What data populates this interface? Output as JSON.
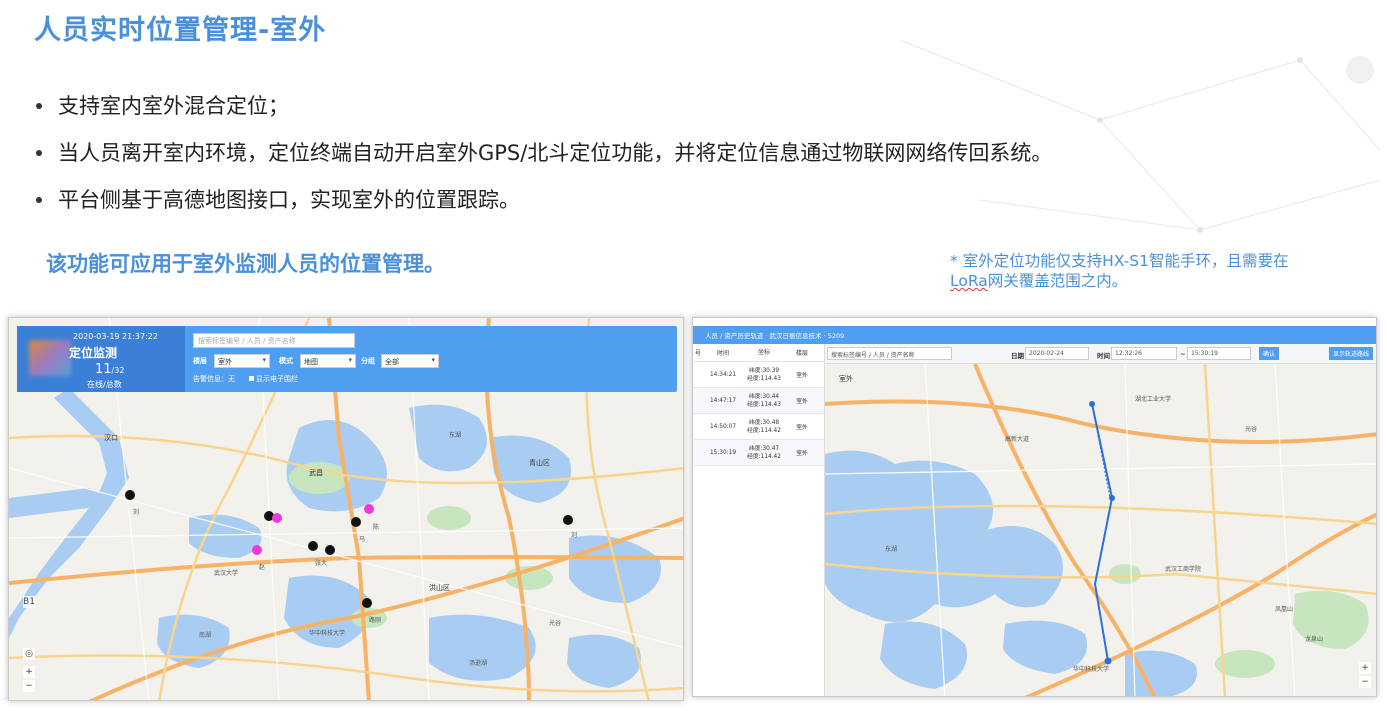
{
  "slide": {
    "title": "人员实时位置管理-室外",
    "bullets": [
      "支持室内室外混合定位；",
      "当人员离开室内环境，定位终端自动开启室外GPS/北斗定位功能，并将定位信息通过物联网网络传回系统。",
      "平台侧基于高德地图接口，实现室外的位置跟踪。"
    ],
    "highlight": "该功能可应用于室外监测人员的位置管理。",
    "footnote_line1": "* 室外定位功能仅支持HX-S1智能手环，且需要在",
    "footnote_line2_a": "LoRa",
    "footnote_line2_b": "网关覆盖范围之内。"
  },
  "left_panel": {
    "timestamp": "2020-03-19 21:37:22",
    "monitor_title": "定位监测",
    "count_main": "11",
    "count_sub": "/32",
    "online_label": "在线/总数",
    "search_placeholder": "搜索标签编号 / 人员 / 资产名称",
    "floor_label": "楼层",
    "floor_value": "室外",
    "mode_label": "模式",
    "mode_value": "地图",
    "group_label": "分组",
    "group_value": "全部",
    "alarm_text": "告警信息：无",
    "fence_text": "显示电子围栏",
    "zoom_in": "+",
    "zoom_out": "−",
    "floor_indicator": "B1",
    "map_labels": {
      "hankou": "汉口",
      "wuchang": "武昌",
      "hongshan": "洪山区",
      "qingshan": "青山区",
      "guanggu": "光谷",
      "wuda": "武汉大学",
      "huake": "华中科技大学",
      "donghu": "东湖",
      "nanhu": "南湖",
      "tangxun": "汤逊湖"
    },
    "marker_labels": [
      "刘",
      "张大",
      "赵",
      "马",
      "刘",
      "陈",
      "路刚"
    ]
  },
  "right_panel": {
    "breadcrumb": "人员 / 资产历史轨迹 · 武汉日振信息技术 · 5209",
    "search_placeholder": "搜索标签编号 / 人员 / 资产名称",
    "date_label": "日期",
    "date_value": "2020-02-24",
    "time_label": "时间",
    "time_from": "12:32:26",
    "time_sep": "~",
    "time_to": "15:30:19",
    "confirm_button": "确认",
    "show_track_button": "显示轨迹路线",
    "table_headers": [
      "号",
      "时间",
      "坐标",
      "楼层"
    ],
    "rows": [
      {
        "time": "14:34:21",
        "lat": "纬度:30.39",
        "lng": "经度:114.43",
        "floor": "室外"
      },
      {
        "time": "14:47:17",
        "lat": "纬度:30.44",
        "lng": "经度:114.43",
        "floor": "室外"
      },
      {
        "time": "14:50:07",
        "lat": "纬度:30.48",
        "lng": "经度:114.42",
        "floor": "室外"
      },
      {
        "time": "15:30:19",
        "lat": "纬度:30.47",
        "lng": "经度:114.42",
        "floor": "室外"
      }
    ],
    "map_labels": {
      "huake": "华中科技大学",
      "guanggu": "光谷",
      "donghu": "东湖",
      "zhifu": "湖北工业大学",
      "fenghuang": "凤凰山",
      "longquan": "龙泉山",
      "daxue": "武汉工商学院",
      "gaoxin": "高新大道",
      "outside": "室外"
    },
    "zoom_in": "+",
    "zoom_out": "−"
  },
  "colors": {
    "title_blue": "#4a90d9",
    "header_blue": "#4f9ef0",
    "track_blue": "#2a6fe0",
    "marker_pink": "#ee3bd8",
    "marker_black": "#111111"
  }
}
